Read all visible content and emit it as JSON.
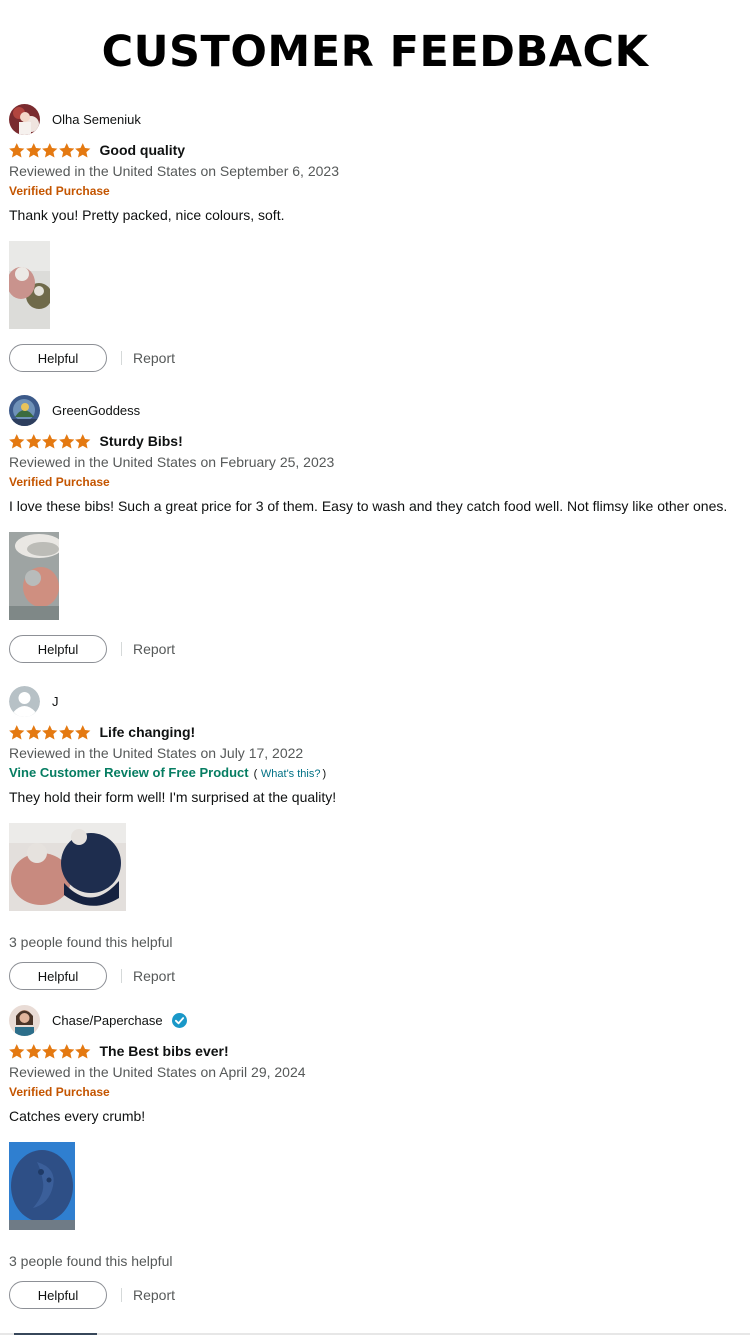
{
  "page": {
    "title": "CUSTOMER FEEDBACK"
  },
  "colors": {
    "star": "#e47911",
    "verified": "#c45500",
    "vine": "#067d62",
    "link": "#007185",
    "muted": "#565959"
  },
  "reviews": [
    {
      "author": "Olha Semeniuk",
      "rating": 5,
      "title": "Good quality",
      "date": "Reviewed in the United States on September 6, 2023",
      "badge": "Verified Purchase",
      "body": "Thank you! Pretty packed, nice colours, soft.",
      "helpful_count": "",
      "helpful_label": "Helpful",
      "report_label": "Report"
    },
    {
      "author": "GreenGoddess",
      "rating": 5,
      "title": "Sturdy Bibs!",
      "date": "Reviewed in the United States on February 25, 2023",
      "badge": "Verified Purchase",
      "body": "I love these bibs! Such a great price for 3 of them. Easy to wash and they catch food well. Not flimsy like other ones.",
      "helpful_count": "",
      "helpful_label": "Helpful",
      "report_label": "Report"
    },
    {
      "author": "J",
      "rating": 5,
      "title": "Life changing!",
      "date": "Reviewed in the United States on July 17, 2022",
      "vine_label": "Vine Customer Review of Free Product",
      "vine_link": "What's this?",
      "body": "They hold their form well! I'm surprised at the quality!",
      "helpful_count": "3 people found this helpful",
      "helpful_label": "Helpful",
      "report_label": "Report"
    },
    {
      "author": "Chase/Paperchase",
      "rating": 5,
      "title": "The Best bibs ever!",
      "date": "Reviewed in the United States on April 29, 2024",
      "badge": "Verified Purchase",
      "body": "Catches every crumb!",
      "helpful_count": "3 people found this helpful",
      "helpful_label": "Helpful",
      "report_label": "Report"
    }
  ]
}
